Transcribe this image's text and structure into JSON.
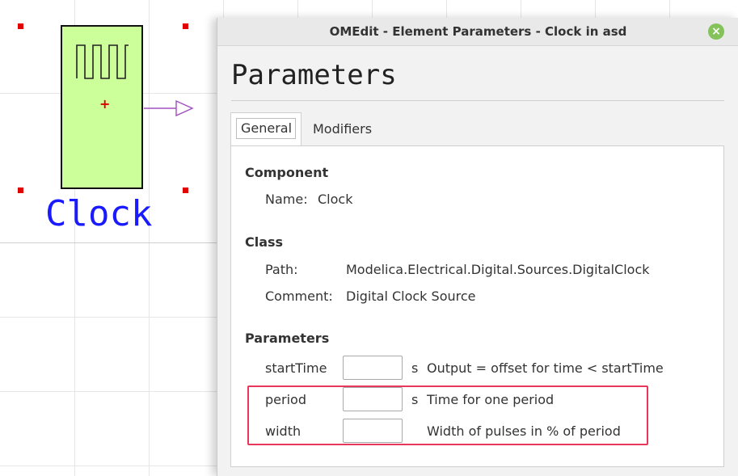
{
  "canvas": {
    "component_label": "Clock"
  },
  "dialog": {
    "title": "OMEdit - Element Parameters - Clock in asd",
    "close_icon": "close-icon",
    "heading": "Parameters",
    "tabs": [
      {
        "label": "General",
        "selected": true
      },
      {
        "label": "Modifiers",
        "selected": false
      }
    ],
    "component": {
      "section_title": "Component",
      "name_label": "Name:",
      "name_value": "Clock"
    },
    "class": {
      "section_title": "Class",
      "path_label": "Path:",
      "path_value": "Modelica.Electrical.Digital.Sources.DigitalClock",
      "comment_label": "Comment:",
      "comment_value": "Digital Clock Source"
    },
    "parameters": {
      "section_title": "Parameters",
      "rows": [
        {
          "name": "startTime",
          "value": "",
          "unit": "s",
          "description": "Output = offset for time < startTime"
        },
        {
          "name": "period",
          "value": "",
          "unit": "s",
          "description": "Time for one period"
        },
        {
          "name": "width",
          "value": "",
          "unit": "",
          "description": "Width of pulses in % of period"
        }
      ]
    }
  },
  "colors": {
    "block_fill": "#ccff99",
    "label_blue": "#1a1aff",
    "selection_handle": "#e00000",
    "highlight_border": "#e8375a",
    "close_button": "#83c35a"
  }
}
